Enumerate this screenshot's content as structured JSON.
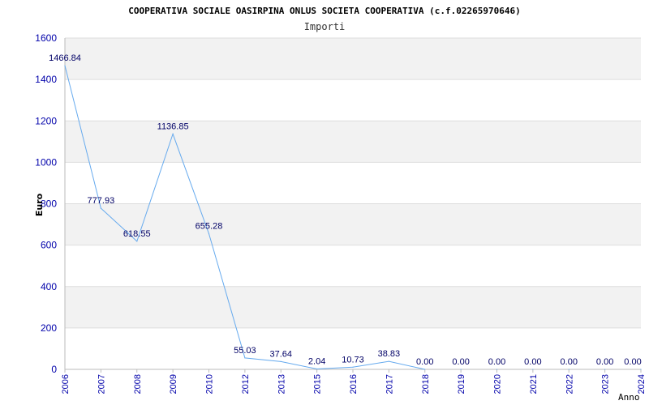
{
  "chart_data": {
    "type": "line",
    "title": "COOPERATIVA SOCIALE OASIRPINA ONLUS SOCIETA COOPERATIVA (c.f.02265970646)",
    "subtitle": "Importi",
    "xlabel": "Anno",
    "ylabel": "Euro",
    "ylim": [
      0,
      1600
    ],
    "yticks": [
      0,
      200,
      400,
      600,
      800,
      1000,
      1200,
      1400,
      1600
    ],
    "grid": true,
    "categories": [
      "2006",
      "2007",
      "2008",
      "2009",
      "2010",
      "2012",
      "2013",
      "2015",
      "2016",
      "2017",
      "2018",
      "2019",
      "2020",
      "2021",
      "2022",
      "2023",
      "2024"
    ],
    "series": [
      {
        "values": [
          1466.84,
          777.93,
          618.55,
          1136.85,
          655.28,
          55.03,
          37.64,
          2.04,
          10.73,
          38.83,
          0.0,
          0.0,
          0.0,
          0.0,
          0.0,
          0.0,
          0.0
        ],
        "labels": [
          "1466.84",
          "777.93",
          "618.55",
          "1136.85",
          "655.28",
          "55.03",
          "37.64",
          "2.04",
          "10.73",
          "38.83",
          "0.00",
          "0.00",
          "0.00",
          "0.00",
          "0.00",
          "0.00",
          "0.00"
        ],
        "color": "#66aaee"
      }
    ],
    "colors": {
      "band": "#f2f2f2",
      "grid": "#dddddd",
      "tick_text": "#0000aa",
      "data_label": "#000066"
    }
  }
}
